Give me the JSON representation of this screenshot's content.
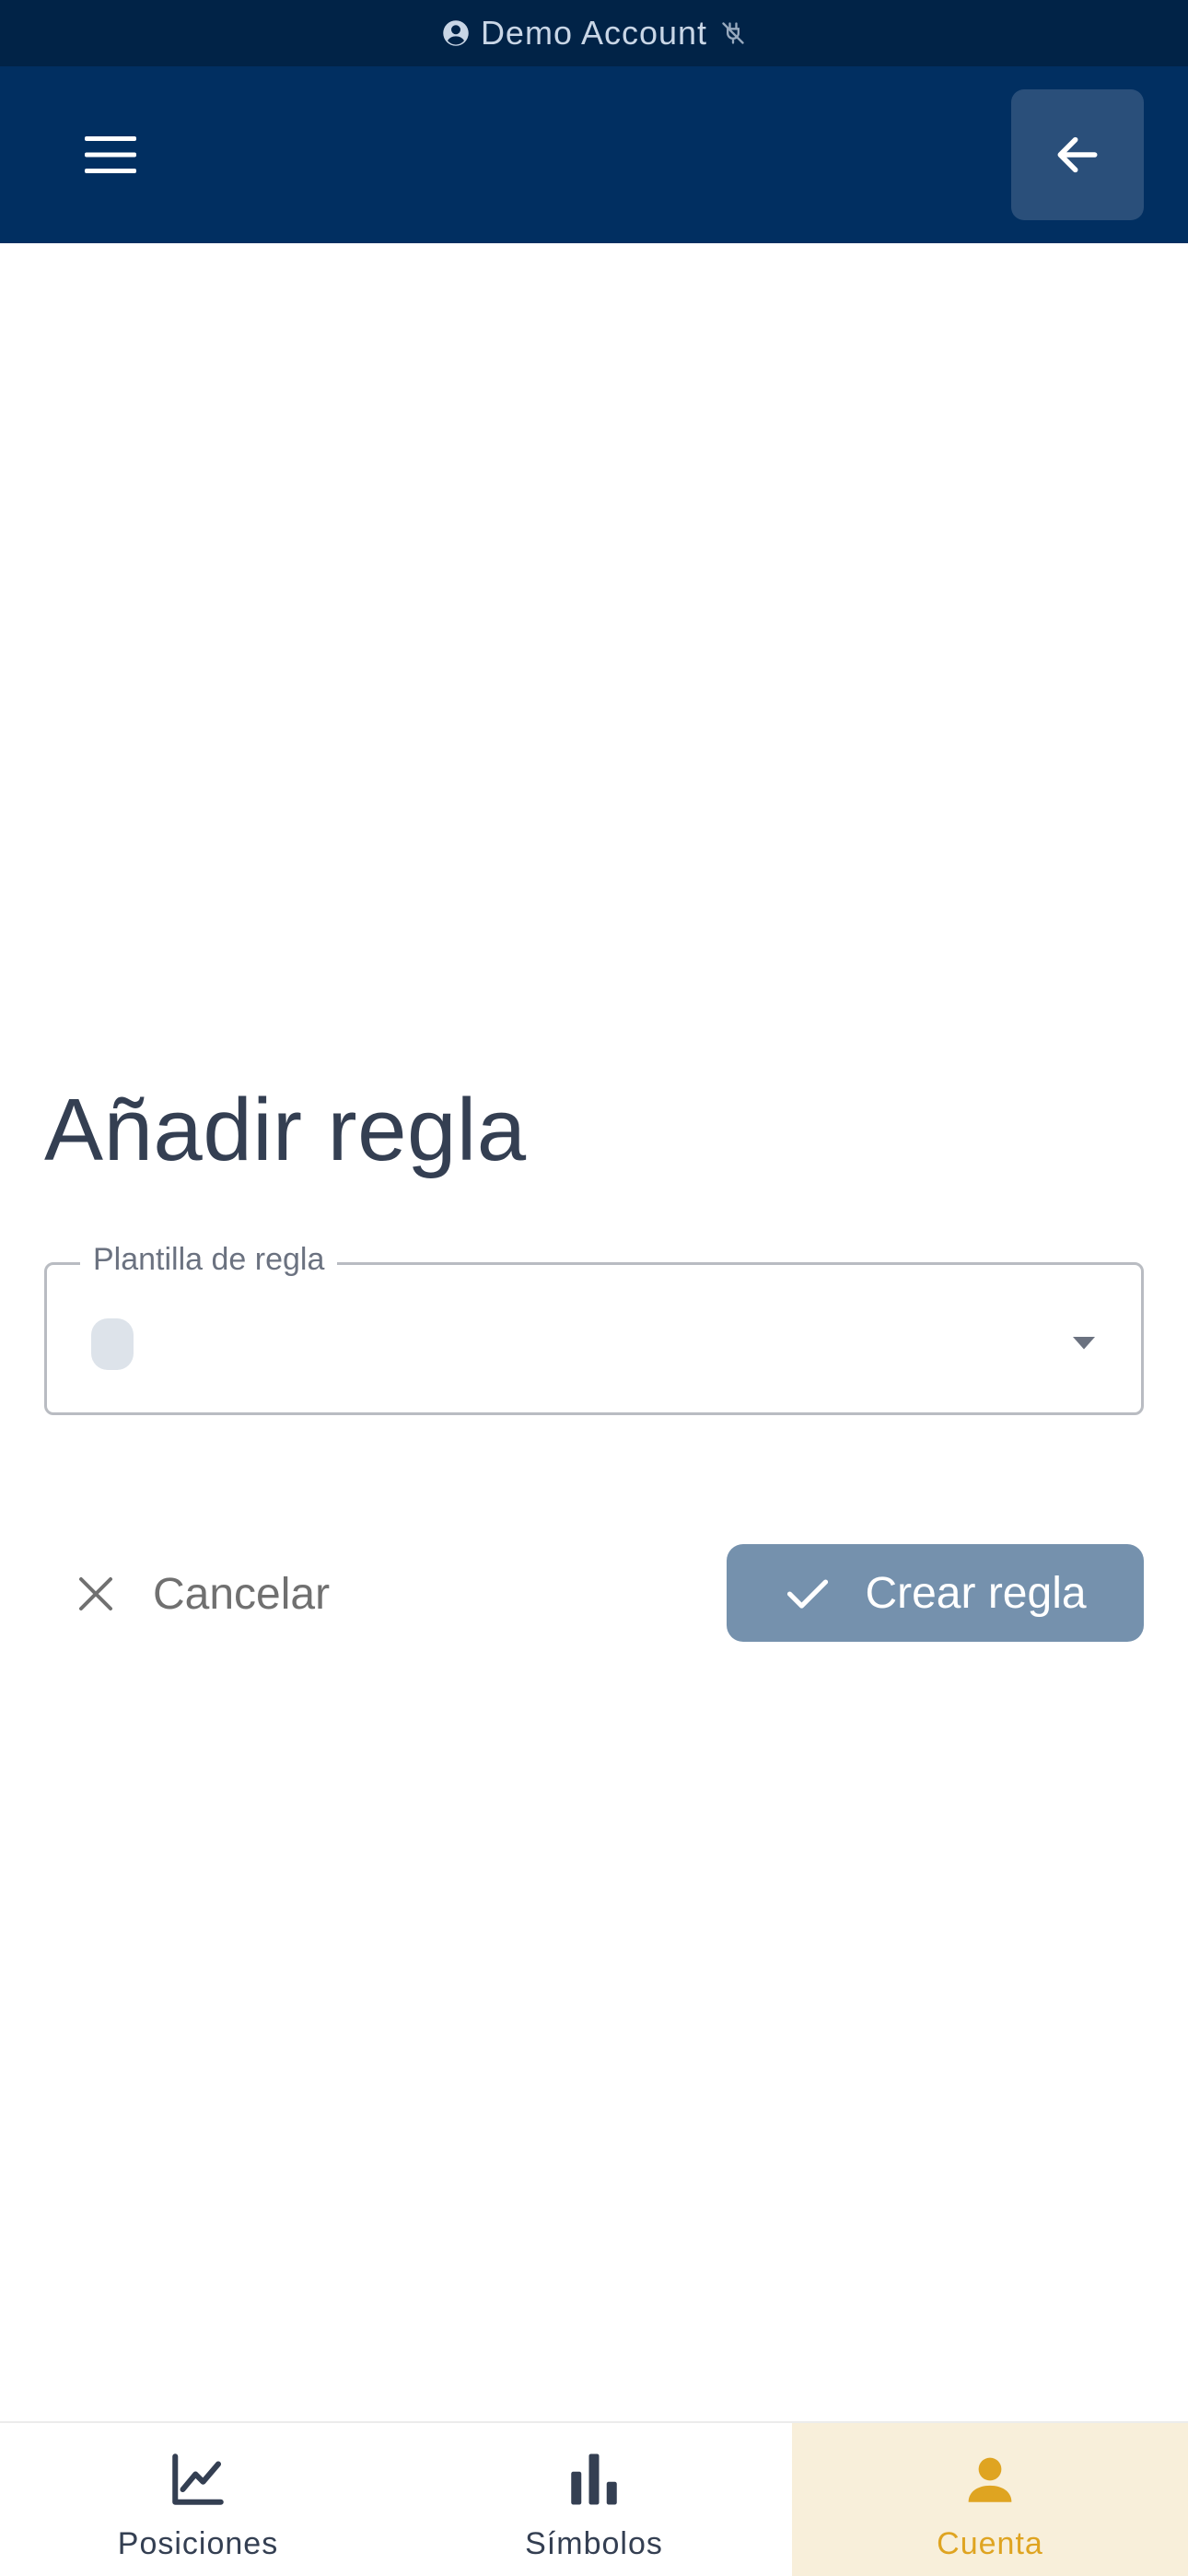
{
  "demo_bar": {
    "label": "Demo Account"
  },
  "app_bar": {},
  "main": {
    "title": "Añadir regla",
    "template_select": {
      "label": "Plantilla de regla",
      "value": ""
    },
    "cancel_label": "Cancelar",
    "create_label": "Crear regla"
  },
  "bottom_nav": {
    "items": [
      {
        "label": "Posiciones",
        "icon": "line-chart-icon",
        "active": false
      },
      {
        "label": "Símbolos",
        "icon": "bar-chart-icon",
        "active": false
      },
      {
        "label": "Cuenta",
        "icon": "person-icon",
        "active": true
      }
    ]
  },
  "colors": {
    "demo_bar_bg": "#012347",
    "app_bar_bg": "#012f61",
    "accent": "#dfa421",
    "primary_button": "#7591ad",
    "text_dark": "#343f52"
  }
}
